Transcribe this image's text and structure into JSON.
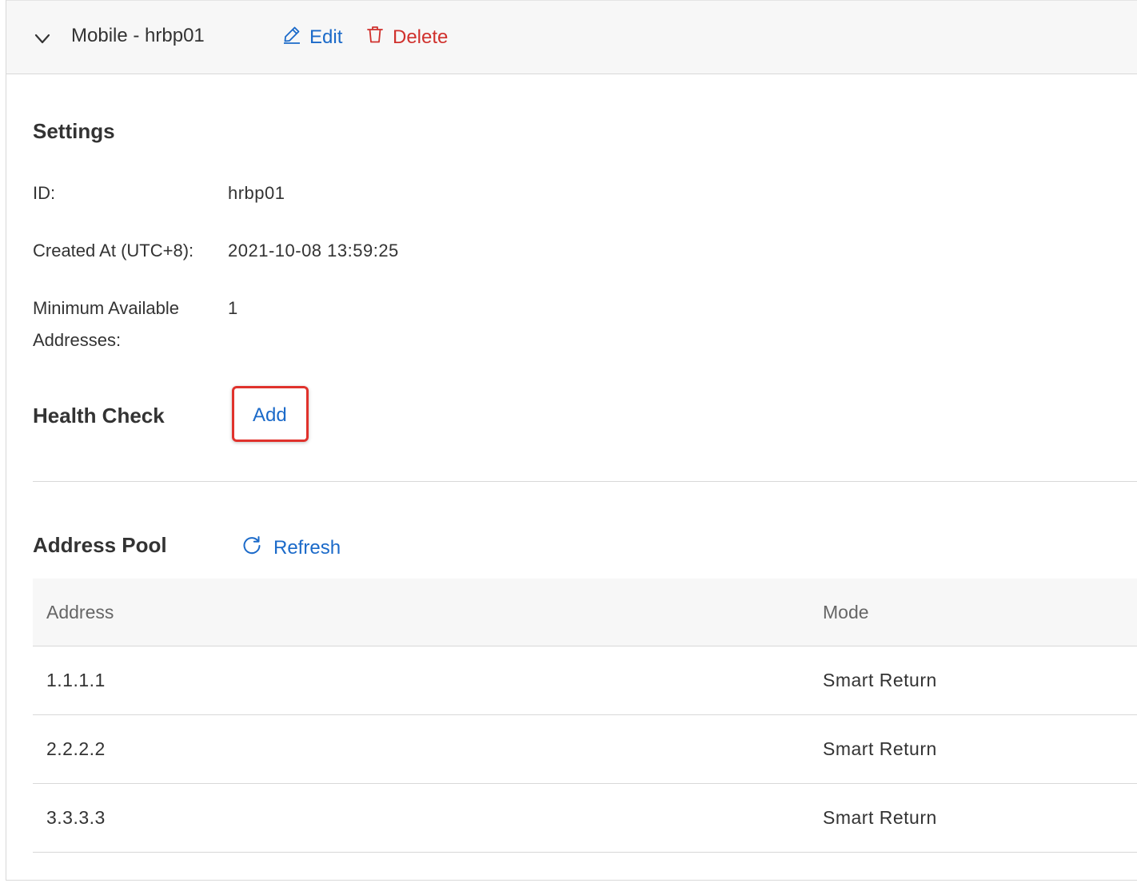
{
  "colors": {
    "link": "#1b6ac9",
    "danger": "#d0312d",
    "highlight": "#e0322c"
  },
  "header": {
    "title": "Mobile - hrbp01",
    "edit_label": "Edit",
    "delete_label": "Delete"
  },
  "settings": {
    "title": "Settings",
    "id_label": "ID:",
    "id_value": "hrbp01",
    "created_label": "Created At (UTC+8):",
    "created_value": "2021-10-08 13:59:25",
    "min_label": "Minimum Available Addresses:",
    "min_value": "1"
  },
  "health_check": {
    "title": "Health Check",
    "add_label": "Add"
  },
  "address_pool": {
    "title": "Address Pool",
    "refresh_label": "Refresh",
    "columns": [
      "Address",
      "Mode"
    ],
    "rows": [
      {
        "address": "1.1.1.1",
        "mode": "Smart Return"
      },
      {
        "address": "2.2.2.2",
        "mode": "Smart Return"
      },
      {
        "address": "3.3.3.3",
        "mode": "Smart Return"
      }
    ]
  }
}
